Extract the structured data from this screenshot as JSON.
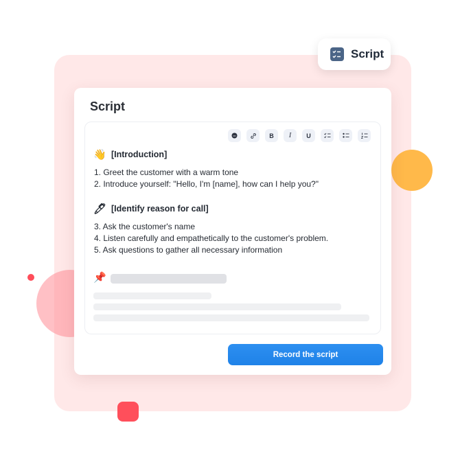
{
  "badge": {
    "icon": "checklist-icon",
    "label": "Script"
  },
  "card": {
    "title": "Script",
    "toolbar": [
      {
        "name": "emoji-button",
        "icon": "emoji-icon",
        "glyph": "●"
      },
      {
        "name": "link-button",
        "icon": "link-icon",
        "glyph": "🔗"
      },
      {
        "name": "bold-button",
        "icon": "bold-icon",
        "glyph": "B"
      },
      {
        "name": "italic-button",
        "icon": "italic-icon",
        "glyph": "I"
      },
      {
        "name": "underline-button",
        "icon": "underline-icon",
        "glyph": "U"
      },
      {
        "name": "checklist-button",
        "icon": "checklist-icon",
        "glyph": "☑"
      },
      {
        "name": "bullet-list-button",
        "icon": "bullet-list-icon",
        "glyph": "•"
      },
      {
        "name": "numbered-list-button",
        "icon": "numbered-list-icon",
        "glyph": "1"
      }
    ],
    "sections": [
      {
        "emoji": "👋",
        "emoji_name": "waving-hand-icon",
        "heading": "[Introduction]",
        "items": [
          "1. Greet the customer with a warm tone",
          "2. Introduce yourself: \"Hello, I'm [name], how can I help you?\""
        ]
      },
      {
        "emoji": "🖊",
        "emoji_name": "pen-icon",
        "heading": "[Identify reason for call]",
        "items": [
          "3. Ask the customer's name",
          "4. Listen carefully and empathetically to the customer's problem.",
          "5. Ask questions to gather all necessary information"
        ]
      },
      {
        "emoji": "📌",
        "emoji_name": "pushpin-icon",
        "heading": "",
        "items": []
      }
    ],
    "record_button": "Record the script"
  },
  "colors": {
    "accent": "#1f82e8",
    "panel_bg": "#ffe8e8",
    "badge_icon": "#4b6587",
    "deco_yellow": "#ffb94a",
    "deco_red": "#ff4f5b"
  }
}
